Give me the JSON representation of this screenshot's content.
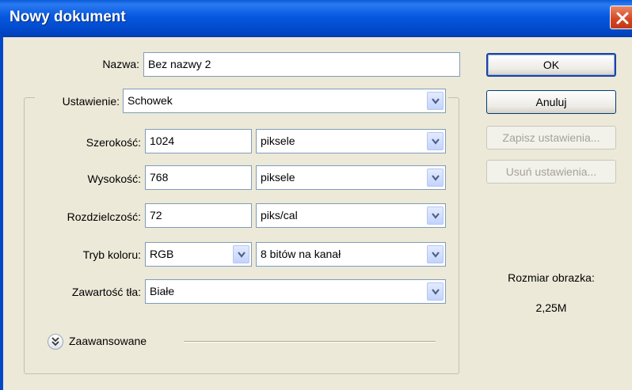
{
  "window": {
    "title": "Nowy dokument"
  },
  "form": {
    "name_label": "Nazwa:",
    "name_value": "Bez nazwy 2",
    "preset_label": "Ustawienie:",
    "preset_value": "Schowek",
    "width_label": "Szerokość:",
    "width_value": "1024",
    "width_unit": "piksele",
    "height_label": "Wysokość:",
    "height_value": "768",
    "height_unit": "piksele",
    "resolution_label": "Rozdzielczość:",
    "resolution_value": "72",
    "resolution_unit": "piks/cal",
    "color_mode_label": "Tryb koloru:",
    "color_mode_value": "RGB",
    "bit_depth_value": "8 bitów na kanał",
    "background_label": "Zawartość tła:",
    "background_value": "Białe",
    "advanced_label": "Zaawansowane"
  },
  "buttons": {
    "ok": "OK",
    "cancel": "Anuluj",
    "save_preset": "Zapisz ustawienia...",
    "delete_preset": "Usuń ustawienia..."
  },
  "info": {
    "image_size_label": "Rozmiar obrazka:",
    "image_size_value": "2,25M"
  },
  "colors": {
    "titlebar": "#0054e3",
    "dialog_background": "#ece9d8",
    "field_border": "#7f9db9",
    "close_button": "#d44520"
  }
}
